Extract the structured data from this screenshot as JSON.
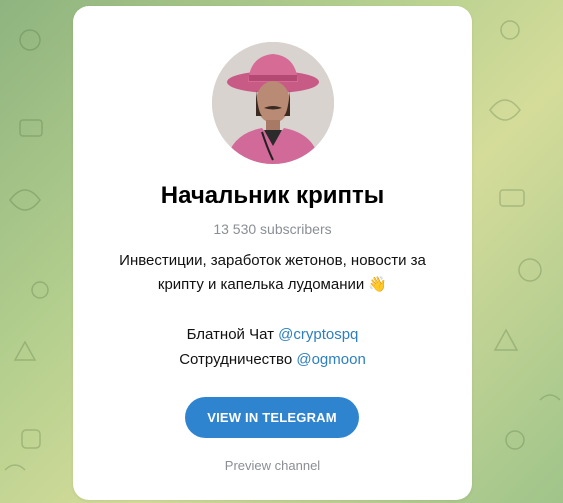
{
  "channel": {
    "title": "Начальник крипты",
    "subscribers": "13 530 subscribers",
    "description_line1": "Инвестиции, заработок жетонов, новости за",
    "description_line2": "крипту и капелька лудомании",
    "description_emoji": "👋",
    "links": [
      {
        "label": "Блатной Чат",
        "handle": "@cryptospq"
      },
      {
        "label": "Сотрудничество",
        "handle": "@ogmoon"
      }
    ]
  },
  "actions": {
    "view_button": "VIEW IN TELEGRAM",
    "preview_link": "Preview channel"
  },
  "colors": {
    "accent": "#2f84d0",
    "link": "#2d7fbf",
    "muted": "#8a8f95"
  },
  "icons": {
    "avatar": "channel-avatar-photo"
  }
}
